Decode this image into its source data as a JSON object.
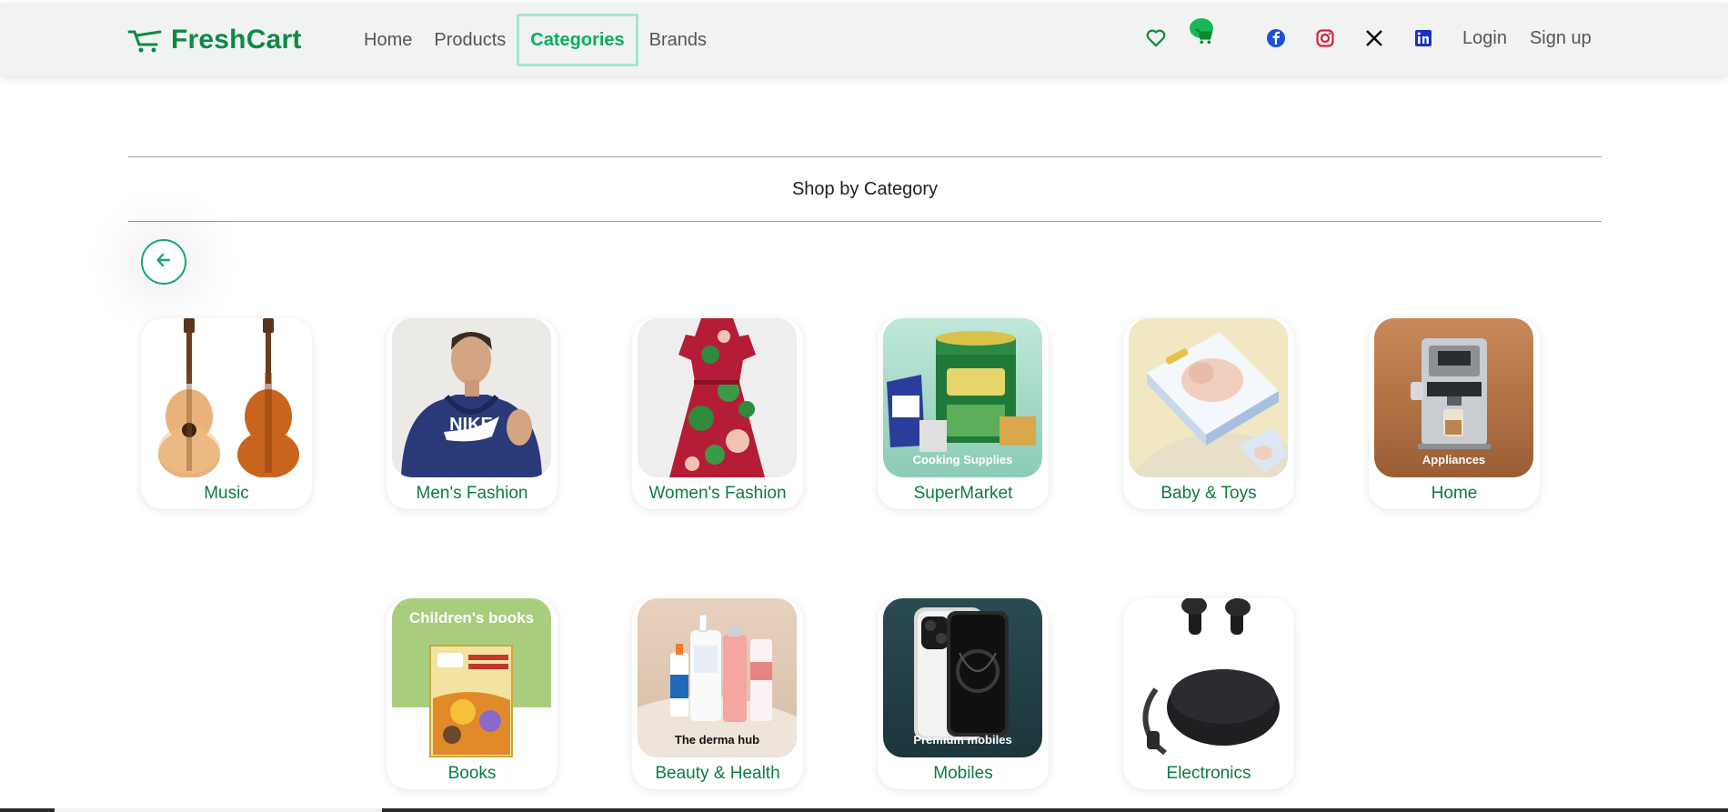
{
  "nav": {
    "brand": "FreshCart",
    "links": [
      "Home",
      "Products",
      "Categories",
      "Brands"
    ],
    "active_link": "Categories",
    "login": "Login",
    "signup": "Sign up"
  },
  "icons": {
    "brand": "cart-icon",
    "wishlist": "heart-icon",
    "cart": "cart-icon",
    "social": [
      "facebook-icon",
      "instagram-icon",
      "x-icon",
      "linkedin-icon"
    ],
    "back": "arrow-left-icon"
  },
  "section": {
    "title": "Shop by Category"
  },
  "categories": [
    {
      "name": "Music",
      "image": "guitars"
    },
    {
      "name": "Men's Fashion",
      "image": "man-in-hoodie"
    },
    {
      "name": "Women's Fashion",
      "image": "floral-dress"
    },
    {
      "name": "SuperMarket",
      "image": "groceries",
      "tag": "Cooking Supplies"
    },
    {
      "name": "Baby & Toys",
      "image": "diapers-pack"
    },
    {
      "name": "Home",
      "image": "coffee-machine",
      "tag": "Appliances"
    },
    {
      "name": "Books",
      "image": "childrens-book",
      "header": "Children's books"
    },
    {
      "name": "Beauty & Health",
      "image": "skincare-bottles",
      "tag": "The derma hub"
    },
    {
      "name": "Mobiles",
      "image": "smartphone",
      "tag": "Premium mobiles"
    },
    {
      "name": "Electronics",
      "image": "earbuds"
    }
  ],
  "colors": {
    "brand": "#0a8a44",
    "accent": "#18b85a",
    "nav_bg": "#f1f3f2"
  }
}
